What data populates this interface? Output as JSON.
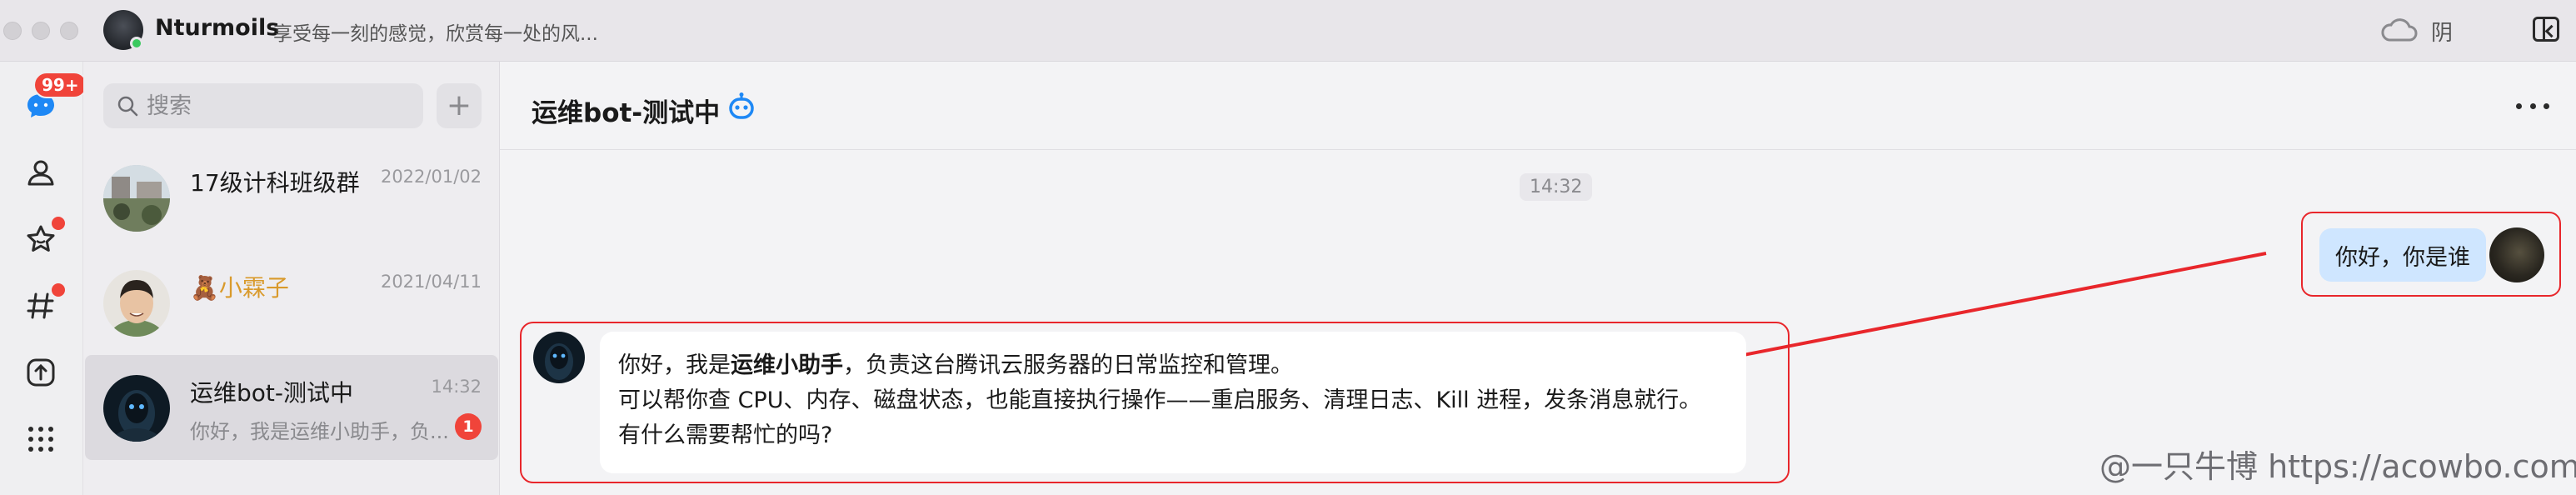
{
  "titlebar": {
    "user_name": "Nturmoils",
    "status_text": "享受每一刻的感觉，欣赏每一处的风...",
    "weather_icon": "cloud-icon",
    "weather_text": "阴",
    "panel_icon": "collapse-panel-icon"
  },
  "rail": {
    "chat_badge": "99+",
    "items": [
      "chat-icon",
      "contacts-icon",
      "favorites-icon",
      "channels-icon",
      "app-icon",
      "apps-grid-icon"
    ]
  },
  "search": {
    "placeholder": "搜索"
  },
  "conversations": [
    {
      "name": "17级计科班级群",
      "time": "2022/01/02",
      "preview": ""
    },
    {
      "name": "小霖子",
      "emoji": "🧸",
      "time": "2021/04/11",
      "preview": ""
    },
    {
      "name": "运维bot-测试中",
      "time": "14:32",
      "preview": "你好，我是运维小助手，负...",
      "unread": "1"
    }
  ],
  "chat": {
    "title": "运维bot-测试中",
    "time_separator": "14:32",
    "outgoing_message": "你好，你是谁",
    "incoming": {
      "line1_prefix": "你好，我是",
      "line1_bold": "运维小助手",
      "line1_suffix": "，负责这台腾讯云服务器的日常监控和管理。",
      "line2": "可以帮你查 CPU、内存、磁盘状态，也能直接执行操作——重启服务、清理日志、Kill 进程，发条消息就行。",
      "line3": "有什么需要帮忙的吗?"
    }
  },
  "watermark": "@一只牛博 https://acowbo.com",
  "colors": {
    "accent_blue": "#1e88f5",
    "badge_red": "#f0443a",
    "annotation_red": "#e8262b",
    "outgoing_bubble": "#cfe6ff"
  }
}
